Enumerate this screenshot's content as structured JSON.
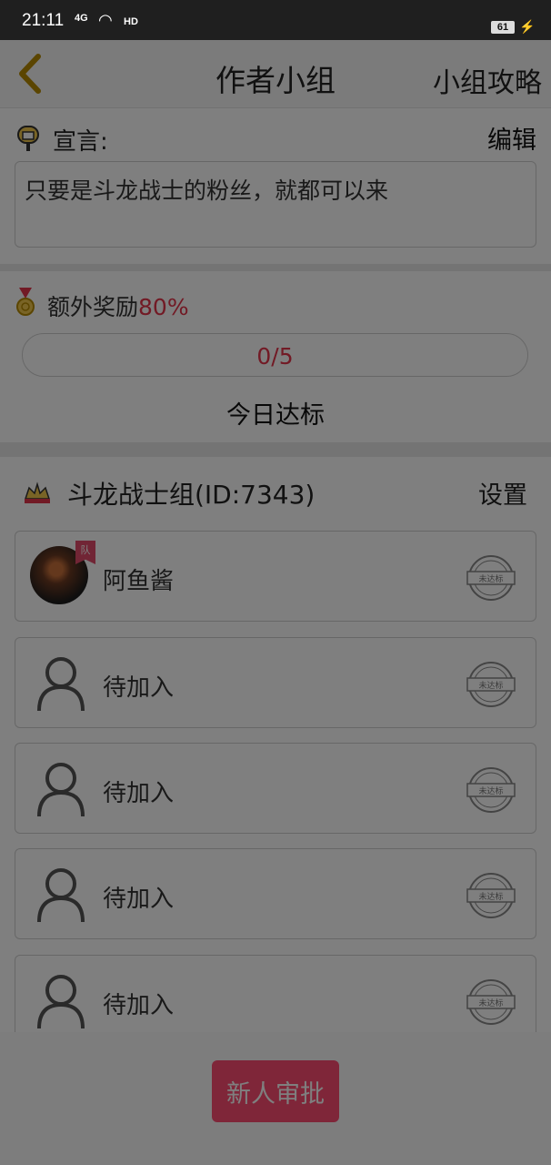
{
  "status": {
    "time": "21:11",
    "network": "4G",
    "hd": "HD",
    "battery": "61"
  },
  "header": {
    "title": "作者小组",
    "strategy": "小组攻略"
  },
  "slogan": {
    "label": "宣言:",
    "edit": "编辑",
    "text": "只要是斗龙战士的粉丝，就都可以来"
  },
  "bonus": {
    "label": "额外奖励",
    "percent": "80%"
  },
  "progress": {
    "text": "0/5",
    "fraction": 0.0,
    "caption": "今日达标"
  },
  "group": {
    "name": "斗龙战士组(ID:7343)",
    "settings": "设置"
  },
  "members": [
    {
      "name": "阿鱼酱",
      "badge": "队",
      "stamp": "未达标",
      "icon": "member-avatar"
    },
    {
      "name": "待加入",
      "stamp": "未达标",
      "icon": "person-placeholder-icon"
    },
    {
      "name": "待加入",
      "stamp": "未达标",
      "icon": "person-placeholder-icon"
    },
    {
      "name": "待加入",
      "stamp": "未达标",
      "icon": "person-placeholder-icon"
    },
    {
      "name": "待加入",
      "stamp": "未达标",
      "icon": "person-placeholder-icon"
    }
  ],
  "footer": {
    "approve": "新人审批"
  },
  "colors": {
    "accent": "#ff4d73",
    "bonus": "#e5344a",
    "back": "#b78b00"
  }
}
